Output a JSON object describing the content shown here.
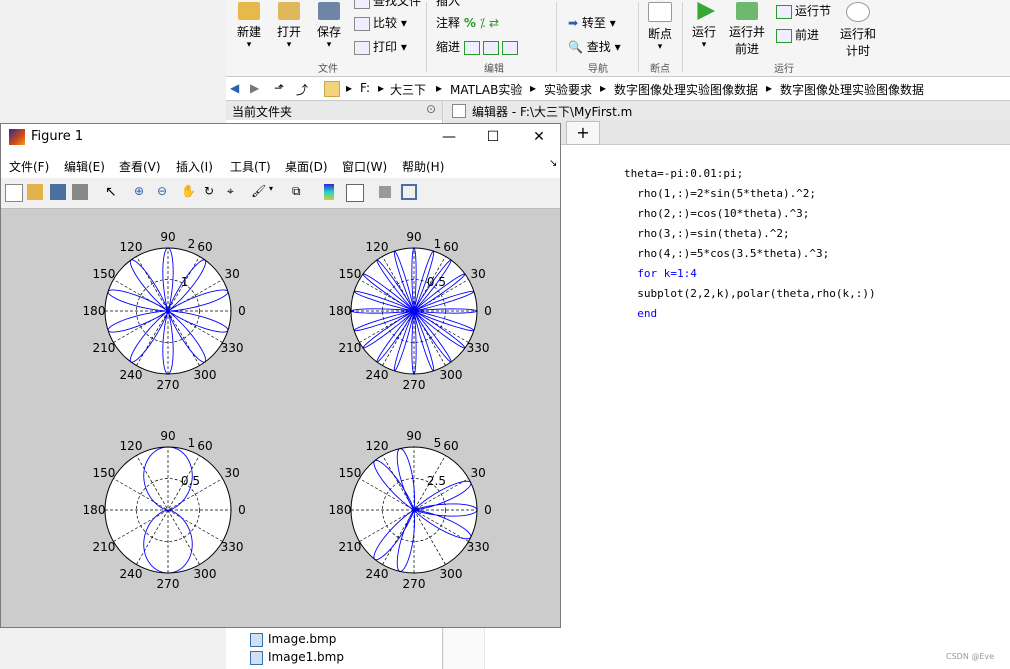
{
  "ribbon": {
    "buttons": {
      "new": "新建",
      "open": "打开",
      "save": "保存",
      "find_files": "查找文件",
      "compare": "比较",
      "print": "打印",
      "insert": "插入",
      "comment": "注释",
      "indent": "缩进",
      "goto": "转至",
      "find": "查找",
      "breakpoints": "断点",
      "run": "运行",
      "run_advance_1": "运行并",
      "run_advance_2": "前进",
      "run_section": "运行节",
      "advance": "前进",
      "run_time_1": "运行和",
      "run_time_2": "计时"
    },
    "groups": {
      "file": "文件",
      "edit": "编辑",
      "navigate": "导航",
      "breakpoints": "断点",
      "run": "运行"
    }
  },
  "address": [
    "F:",
    "大三下",
    "MATLAB实验",
    "实验要求",
    "数字图像处理实验图像数据",
    "数字图像处理实验图像数据"
  ],
  "panel": {
    "current_folder": "当前文件夹"
  },
  "editor": {
    "header": "编辑器 - F:\\大三下\\MyFirst.m",
    "code": [
      "theta=-pi:0.01:pi;",
      "  rho(1,:)=2*sin(5*theta).^2;",
      "  rho(2,:)=cos(10*theta).^3;",
      "  rho(3,:)=sin(theta).^2;",
      "  rho(4,:)=5*cos(3.5*theta).^3;",
      "  for k=1:4",
      "  subplot(2,2,k),polar(theta,rho(k,:))",
      "  end"
    ]
  },
  "files": [
    "Image.bmp",
    "Image1.bmp"
  ],
  "figure": {
    "title": "Figure 1",
    "menu": [
      "文件(F)",
      "编辑(E)",
      "查看(V)",
      "插入(I)",
      "工具(T)",
      "桌面(D)",
      "窗口(W)",
      "帮助(H)"
    ],
    "controls": {
      "minimize": "—",
      "maximize": "☐",
      "close": "✕"
    }
  },
  "colors": {
    "trace": "#0000ff",
    "figure_bg": "#cccccc"
  },
  "chart_data": [
    {
      "type": "polar",
      "formula": "rho = 2*sin(5*theta).^2",
      "theta_range": [
        "-pi",
        "pi"
      ],
      "theta_step": 0.01,
      "rmax": 2,
      "radial_ticks": [
        "1",
        "2"
      ],
      "angle_ticks": [
        "0",
        "30",
        "60",
        "90",
        "120",
        "150",
        "180",
        "210",
        "240",
        "270",
        "300",
        "330"
      ]
    },
    {
      "type": "polar",
      "formula": "rho = cos(10*theta).^3",
      "theta_range": [
        "-pi",
        "pi"
      ],
      "theta_step": 0.01,
      "rmax": 1,
      "radial_ticks": [
        "0.5",
        "1"
      ],
      "angle_ticks": [
        "0",
        "30",
        "60",
        "90",
        "120",
        "150",
        "180",
        "210",
        "240",
        "270",
        "300",
        "330"
      ]
    },
    {
      "type": "polar",
      "formula": "rho = sin(theta).^2",
      "theta_range": [
        "-pi",
        "pi"
      ],
      "theta_step": 0.01,
      "rmax": 1,
      "radial_ticks": [
        "0.5",
        "1"
      ],
      "angle_ticks": [
        "0",
        "30",
        "60",
        "90",
        "120",
        "150",
        "180",
        "210",
        "240",
        "270",
        "300",
        "330"
      ]
    },
    {
      "type": "polar",
      "formula": "rho = 5*cos(3.5*theta).^3",
      "theta_range": [
        "-pi",
        "pi"
      ],
      "theta_step": 0.01,
      "rmax": 5,
      "radial_ticks": [
        "2.5",
        "5"
      ],
      "angle_ticks": [
        "0",
        "30",
        "60",
        "90",
        "120",
        "150",
        "180",
        "210",
        "240",
        "270",
        "300",
        "330"
      ]
    }
  ],
  "watermark": "CSDN @Eve"
}
